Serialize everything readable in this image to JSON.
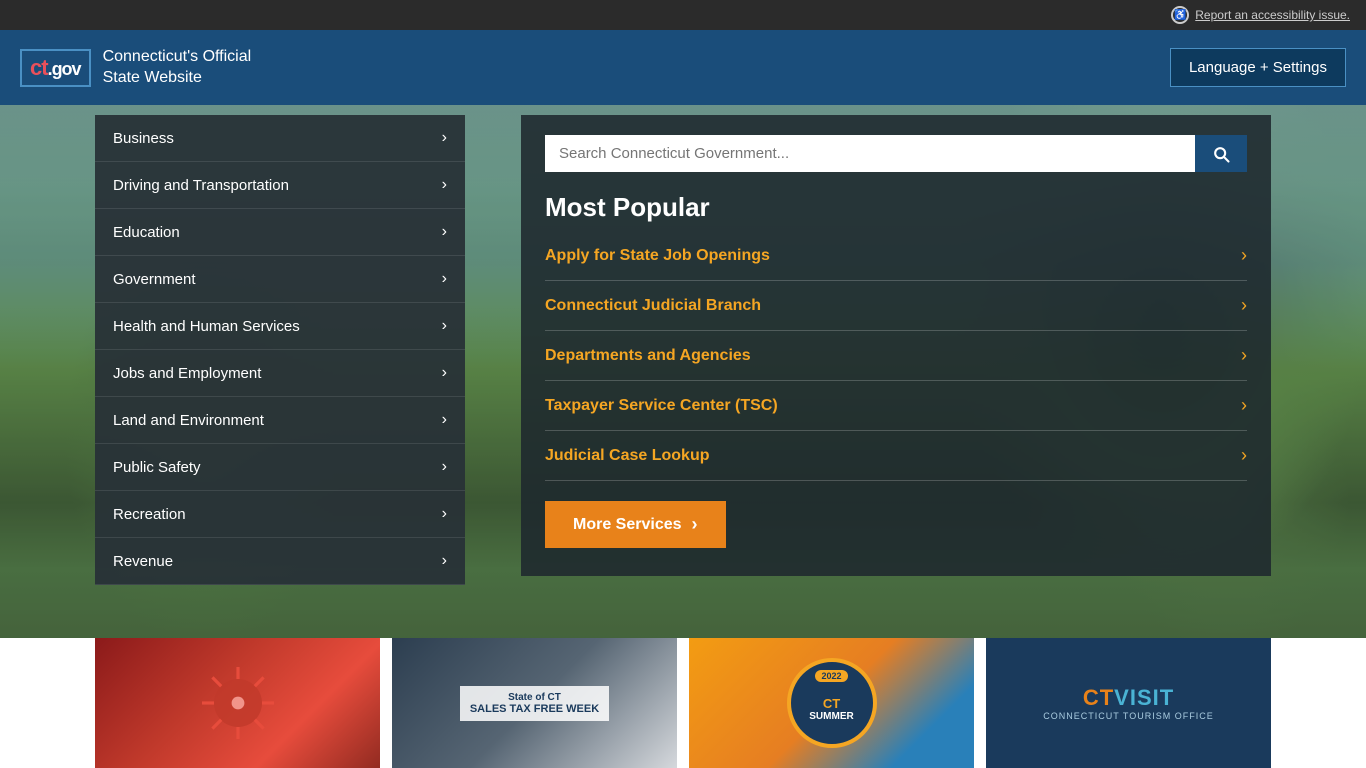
{
  "topbar": {
    "accessibility_label": "Report an accessibility issue."
  },
  "header": {
    "logo_ct": "ct",
    "logo_gov": ".gov",
    "site_title_line1": "Connecticut's Official",
    "site_title_line2": "State Website",
    "lang_btn": "Language + Settings"
  },
  "nav": {
    "items": [
      {
        "id": "business",
        "label": "Business"
      },
      {
        "id": "driving",
        "label": "Driving and Transportation"
      },
      {
        "id": "education",
        "label": "Education"
      },
      {
        "id": "government",
        "label": "Government"
      },
      {
        "id": "health",
        "label": "Health and Human Services"
      },
      {
        "id": "jobs",
        "label": "Jobs and Employment"
      },
      {
        "id": "land",
        "label": "Land and Environment"
      },
      {
        "id": "safety",
        "label": "Public Safety"
      },
      {
        "id": "recreation",
        "label": "Recreation"
      },
      {
        "id": "revenue",
        "label": "Revenue"
      }
    ]
  },
  "search": {
    "placeholder": "Search Connecticut Government...",
    "button_label": "Search"
  },
  "most_popular": {
    "title": "Most Popular",
    "items": [
      {
        "id": "state-jobs",
        "label": "Apply for State Job Openings"
      },
      {
        "id": "judicial",
        "label": "Connecticut Judicial Branch"
      },
      {
        "id": "departments",
        "label": "Departments and Agencies"
      },
      {
        "id": "taxpayer",
        "label": "Taxpayer Service Center (TSC)"
      },
      {
        "id": "case-lookup",
        "label": "Judicial Case Lookup"
      }
    ],
    "more_services_label": "More Services"
  },
  "bottom_cards": [
    {
      "id": "covid",
      "alt": "COVID-19 Information"
    },
    {
      "id": "sales-tax",
      "line1": "State of CT",
      "line2": "SALES TAX FREE WEEK"
    },
    {
      "id": "ct-summer",
      "year": "2022",
      "name": "CTSUMMER"
    },
    {
      "id": "ct-visit",
      "ct": "CT",
      "visit": "VISIT",
      "subtitle": "CONNECTICUT TOURISM OFFICE"
    }
  ],
  "colors": {
    "accent_orange": "#e8821a",
    "header_blue": "#1a4d7a",
    "link_orange": "#f5a623"
  }
}
